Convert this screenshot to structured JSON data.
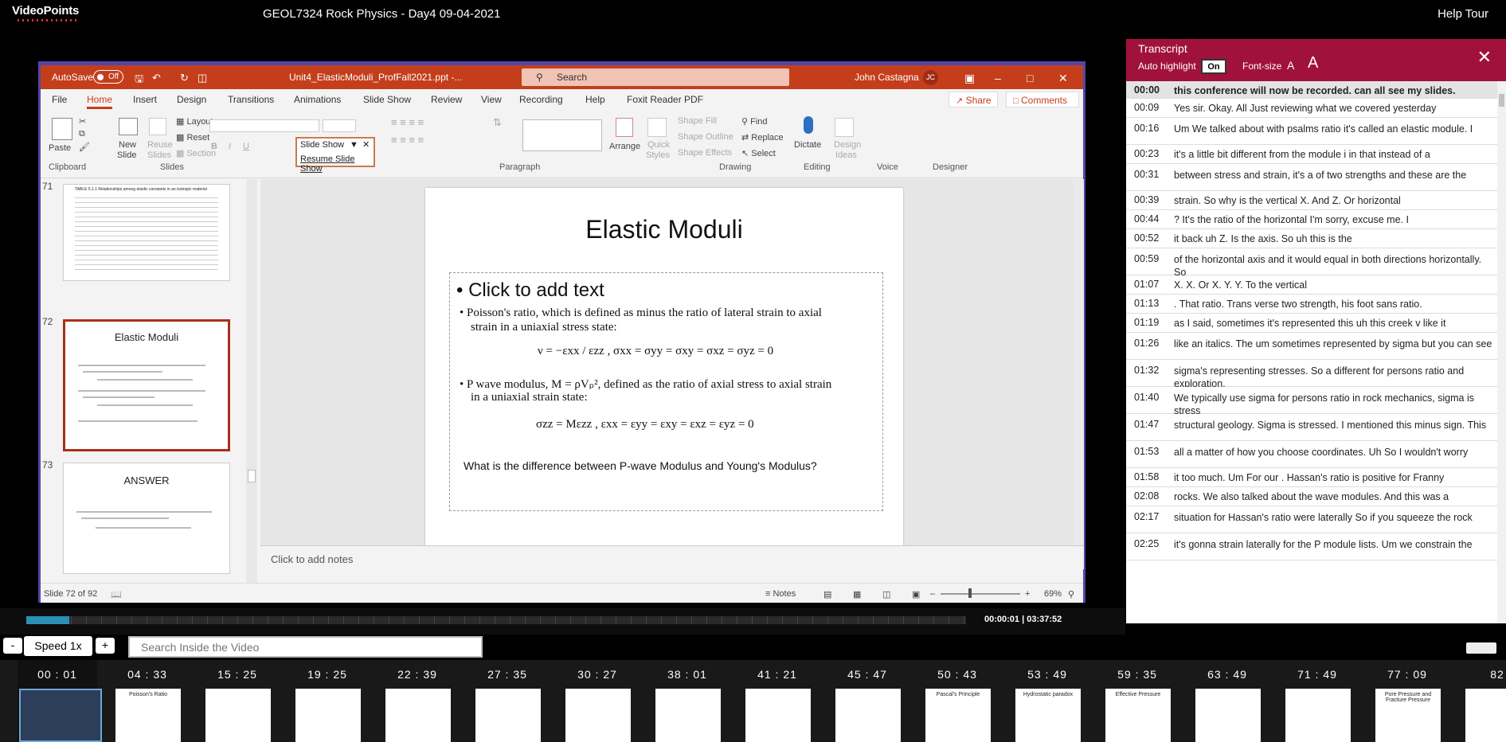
{
  "app": {
    "logo": "VideoPoints",
    "title": "GEOL7324 Rock Physics - Day4 09-04-2021",
    "help_tour": "Help Tour"
  },
  "ppt": {
    "autosave_label": "AutoSave",
    "autosave_state": "Off",
    "filename": "Unit4_ElasticModuli_ProfFall2021.ppt  -...",
    "search_placeholder": "Search",
    "user_name": "John Castagna",
    "user_initials": "JC",
    "tabs": [
      "File",
      "Home",
      "Insert",
      "Design",
      "Transitions",
      "Animations",
      "Slide Show",
      "Review",
      "View",
      "Recording",
      "Help",
      "Foxit Reader PDF"
    ],
    "share": "Share",
    "comments": "Comments",
    "groups": {
      "clipboard": "Clipboard",
      "slides": "Slides",
      "paragraph": "Paragraph",
      "drawing": "Drawing",
      "editing": "Editing",
      "voice": "Voice",
      "designer": "Designer"
    },
    "ribbon": {
      "paste": "Paste",
      "new_slide_1": "New",
      "new_slide_2": "Slide",
      "reuse_1": "Reuse",
      "reuse_2": "Slides",
      "layout": "Layout",
      "reset": "Reset",
      "section": "Section",
      "arrange": "Arrange",
      "quick_1": "Quick",
      "quick_2": "Styles",
      "shape_fill": "Shape Fill",
      "shape_outline": "Shape Outline",
      "shape_effects": "Shape Effects",
      "find": "Find",
      "replace": "Replace",
      "select": "Select",
      "dictate": "Dictate",
      "design_ideas_1": "Design",
      "design_ideas_2": "Ideas"
    },
    "slideshow_menu": {
      "title": "Slide Show",
      "resume": "Resume Slide Show"
    },
    "thumbnails": [
      {
        "num": "71",
        "title": "TABLE 5.1.1 Relationships among elastic constants in an isotropic material"
      },
      {
        "num": "72",
        "title": "Elastic Moduli"
      },
      {
        "num": "73",
        "title": "ANSWER"
      }
    ],
    "slide": {
      "title": "Elastic Moduli",
      "placeholder": "•  Click to add text",
      "bullet1": "•  Poisson's ratio, which is defined as minus the ratio of lateral strain to axial",
      "bullet1b": "strain in a uniaxial stress state:",
      "eq1": "ν = −εxx / εzz ,        σxx = σyy = σxy = σxz = σyz = 0",
      "bullet2": "•  P wave modulus, M = ρVₚ², defined as the ratio of axial stress to axial strain",
      "bullet2b": "in a uniaxial strain state:",
      "eq2": "σzz = Mεzz ,        εxx = εyy = εxy = εxz = εyz = 0",
      "question": "What is the difference between P-wave Modulus and Young's Modulus?"
    },
    "notes_placeholder": "Click to add notes",
    "status": {
      "slide_count": "Slide 72 of 92",
      "notes": "Notes",
      "zoom": "69%"
    }
  },
  "player": {
    "time": "00:00:01 | 03:37:52",
    "progress_fraction": 0.046
  },
  "transcript": {
    "title": "Transcript",
    "auto_highlight": "Auto highlight",
    "auto_state": "On",
    "font_size": "Font-size",
    "a_minus": "A",
    "a_plus": "A",
    "close": "✕",
    "rows": [
      {
        "time": "00:00",
        "text": "this conference will now be recorded. can all see my slides."
      },
      {
        "time": "00:09",
        "text": "Yes sir. Okay. All Just reviewing what we covered yesterday"
      },
      {
        "time": "00:16",
        "text": "Um We talked about with psalms ratio it's called an elastic module. I"
      },
      {
        "time": "00:23",
        "text": "it's a little bit different from the module i in that instead of a"
      },
      {
        "time": "00:31",
        "text": "between stress and strain, it's a of two strengths and these are the"
      },
      {
        "time": "00:39",
        "text": "strain. So why is the vertical X. And Z. Or horizontal"
      },
      {
        "time": "00:44",
        "text": "? It's the ratio of the horizontal I'm sorry, excuse me. I"
      },
      {
        "time": "00:52",
        "text": "it back uh Z. Is the axis. So uh this is the"
      },
      {
        "time": "00:59",
        "text": "of the horizontal axis and it would equal in both directions horizontally. So"
      },
      {
        "time": "01:07",
        "text": "X. X. Or X. Y. Y. To the vertical"
      },
      {
        "time": "01:13",
        "text": ". That ratio. Trans verse two strength, his foot sans ratio."
      },
      {
        "time": "01:19",
        "text": "as I said, sometimes it's represented this uh this creek v like it"
      },
      {
        "time": "01:26",
        "text": "like an italics. The um sometimes represented by sigma but you can see"
      },
      {
        "time": "01:32",
        "text": "sigma's representing stresses. So a different for persons ratio and exploration."
      },
      {
        "time": "01:40",
        "text": "We typically use sigma for persons ratio in rock mechanics, sigma is stress"
      },
      {
        "time": "01:47",
        "text": "structural geology. Sigma is stressed. I mentioned this minus sign. This"
      },
      {
        "time": "01:53",
        "text": "all a matter of how you choose coordinates. Uh So I wouldn't worry"
      },
      {
        "time": "01:58",
        "text": "it too much. Um For our . Hassan's ratio is positive for Franny"
      },
      {
        "time": "02:08",
        "text": "rocks. We also talked about the wave modules. And this was a"
      },
      {
        "time": "02:17",
        "text": "situation for Hassan's ratio were laterally So if you squeeze the rock"
      },
      {
        "time": "02:25",
        "text": "it's gonna strain laterally for the P module lists. Um we constrain the"
      }
    ]
  },
  "controls": {
    "minus": "-",
    "speed": "Speed 1x",
    "plus": "+",
    "search_placeholder": "Search Inside the Video"
  },
  "chapters": [
    "00 : 01",
    "04 : 33",
    "15 : 25",
    "19 : 25",
    "22 : 39",
    "27 : 35",
    "30 : 27",
    "38 : 01",
    "41 : 21",
    "45 : 47",
    "50 : 43",
    "53 : 49",
    "59 : 35",
    "63 : 49",
    "71 : 49",
    "77 : 09",
    "82"
  ],
  "chapter_captions": [
    "",
    "Poisson's Ratio",
    "",
    "",
    "",
    "",
    "",
    "",
    "",
    "",
    "Pascal's Principle",
    "Hydrostatic paradox",
    "Effective Pressure",
    "",
    "",
    "Pore Pressure and Fracture Pressure",
    ""
  ]
}
